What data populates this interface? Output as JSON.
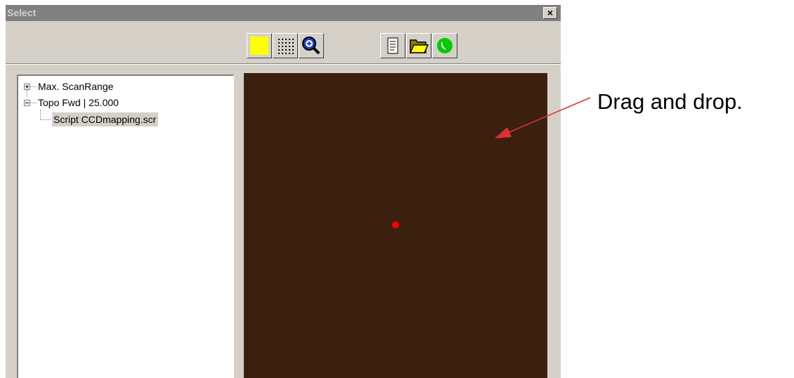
{
  "window": {
    "title": "Select",
    "close_label": "×"
  },
  "toolbar": {
    "buttons": [
      {
        "name": "yellow-square",
        "color": "#ffff00"
      },
      {
        "name": "grid-dots"
      },
      {
        "name": "zoom-magnifier"
      },
      {
        "name": "document"
      },
      {
        "name": "open-folder",
        "color": "#808000"
      },
      {
        "name": "green-circle",
        "color": "#00cc00"
      }
    ]
  },
  "tree": {
    "items": [
      {
        "label": "Max. ScanRange",
        "state": "collapsed"
      },
      {
        "label": "Topo  Fwd  | 25.000",
        "state": "expanded"
      },
      {
        "label": "Script  CCDmapping.scr",
        "selected": true
      }
    ]
  },
  "canvas": {
    "background": "#3b2010",
    "marker_color": "#ff0000"
  },
  "annotation": {
    "text": "Drag and drop.",
    "arrow_color": "#e03030"
  }
}
